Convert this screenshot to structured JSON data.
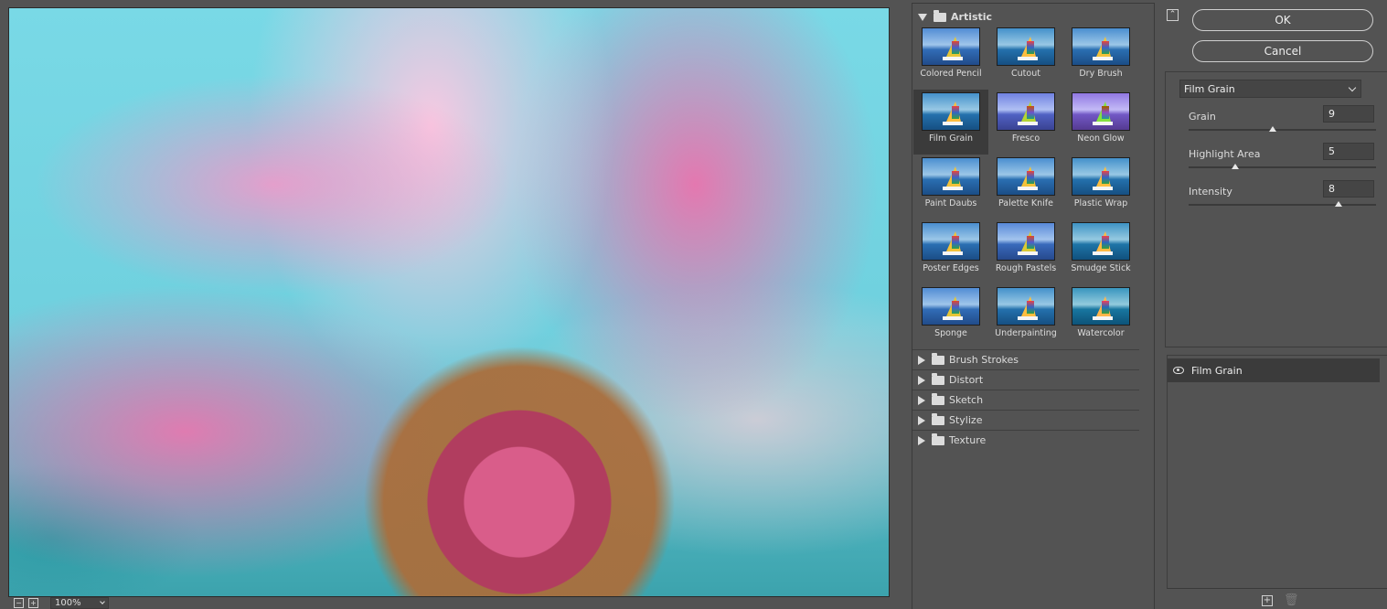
{
  "preview": {
    "zoom": "100%",
    "zoom_out_symbol": "−",
    "zoom_in_symbol": "+"
  },
  "gallery": {
    "open_category": "Artistic",
    "selected_filter": "Film Grain",
    "filters": [
      {
        "label": "Colored Pencil"
      },
      {
        "label": "Cutout"
      },
      {
        "label": "Dry Brush"
      },
      {
        "label": "Film Grain"
      },
      {
        "label": "Fresco"
      },
      {
        "label": "Neon Glow"
      },
      {
        "label": "Paint Daubs"
      },
      {
        "label": "Palette Knife"
      },
      {
        "label": "Plastic Wrap"
      },
      {
        "label": "Poster Edges"
      },
      {
        "label": "Rough Pastels"
      },
      {
        "label": "Smudge Stick"
      },
      {
        "label": "Sponge"
      },
      {
        "label": "Underpainting"
      },
      {
        "label": "Watercolor"
      }
    ],
    "categories": [
      "Brush Strokes",
      "Distort",
      "Sketch",
      "Stylize",
      "Texture"
    ]
  },
  "dialog": {
    "collapse_symbol": "⌃",
    "ok_label": "OK",
    "cancel_label": "Cancel"
  },
  "settings": {
    "filter_name": "Film Grain",
    "params": [
      {
        "label": "Grain",
        "value": "9",
        "max": 20
      },
      {
        "label": "Highlight Area",
        "value": "5",
        "max": 20
      },
      {
        "label": "Intensity",
        "value": "8",
        "max": 10
      }
    ]
  },
  "layers": {
    "items": [
      {
        "label": "Film Grain",
        "visible": true
      }
    ],
    "new_layer_symbol": "+",
    "delete_symbol": "🗑"
  },
  "colors": {
    "panel_bg": "#535353",
    "selected_bg": "#3b3b3b",
    "text": "#dcdcdc"
  }
}
